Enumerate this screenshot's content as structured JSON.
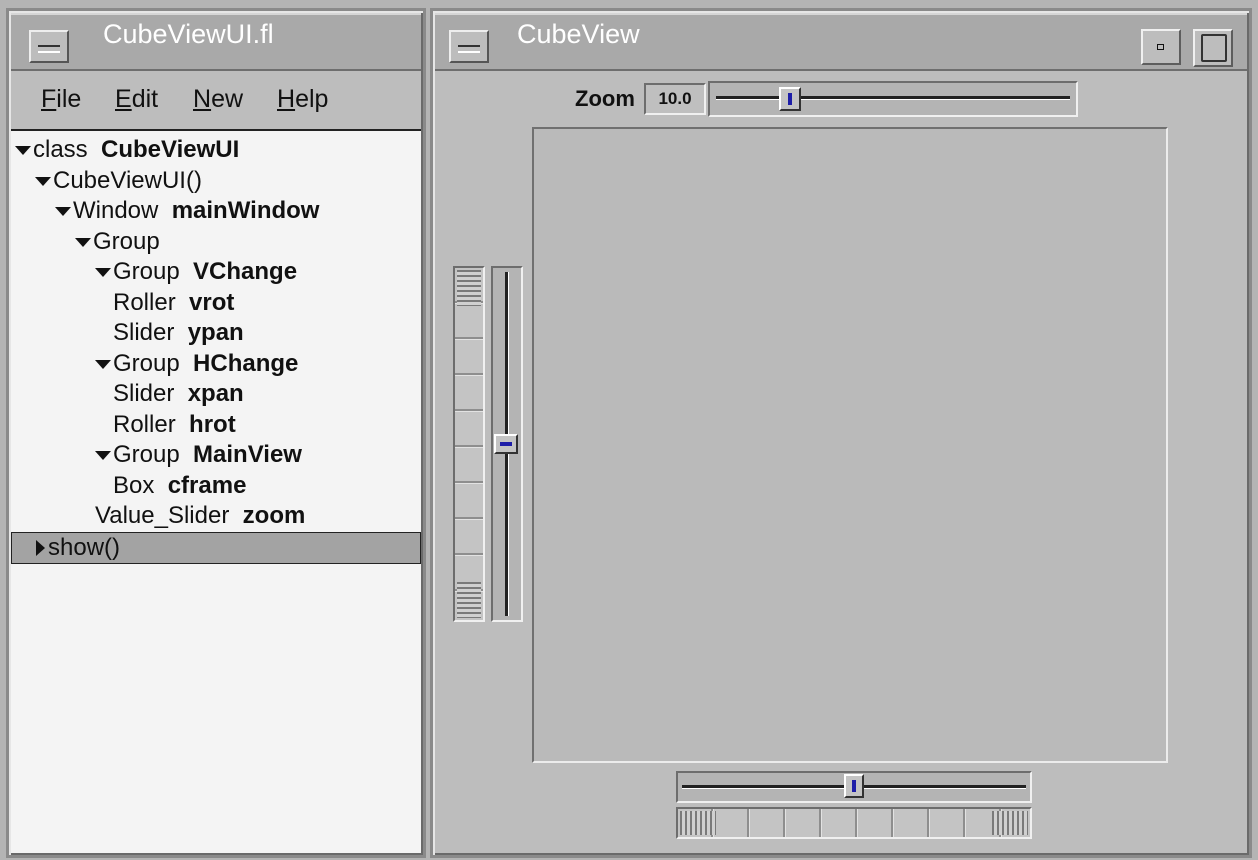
{
  "left_window": {
    "title": "CubeViewUI.fl",
    "menu": [
      {
        "label": "File",
        "accel": "F",
        "rest": "ile"
      },
      {
        "label": "Edit",
        "accel": "E",
        "rest": "dit"
      },
      {
        "label": "New",
        "accel": "N",
        "rest": "ew"
      },
      {
        "label": "Help",
        "accel": "H",
        "rest": "elp"
      }
    ],
    "tree": [
      {
        "expander": "open",
        "type": "class",
        "name": "CubeViewUI"
      },
      {
        "expander": "open",
        "type": "CubeViewUI()",
        "name": ""
      },
      {
        "expander": "open",
        "type": "Window",
        "name": "mainWindow"
      },
      {
        "expander": "open",
        "type": "Group",
        "name": ""
      },
      {
        "expander": "open",
        "type": "Group",
        "name": "VChange"
      },
      {
        "expander": "none",
        "type": "Roller",
        "name": "vrot"
      },
      {
        "expander": "none",
        "type": "Slider",
        "name": "ypan"
      },
      {
        "expander": "open",
        "type": "Group",
        "name": "HChange"
      },
      {
        "expander": "none",
        "type": "Slider",
        "name": "xpan"
      },
      {
        "expander": "none",
        "type": "Roller",
        "name": "hrot"
      },
      {
        "expander": "open",
        "type": "Group",
        "name": "MainView"
      },
      {
        "expander": "none",
        "type": "Box",
        "name": "cframe"
      },
      {
        "expander": "none",
        "type": "Value_Slider",
        "name": "zoom"
      },
      {
        "expander": "closed",
        "type": "show()",
        "name": "",
        "selected": true
      }
    ]
  },
  "right_window": {
    "title": "CubeView",
    "zoom_label": "Zoom",
    "zoom_value": "10.0",
    "zoom_position": 0.19,
    "ypan_position": 0.5,
    "xpan_position": 0.5
  },
  "colors": {
    "accent": "#1e1ea8",
    "panel": "#bdbdbd",
    "tree_background": "#f4f4f4",
    "selection": "#a3a3a3"
  }
}
